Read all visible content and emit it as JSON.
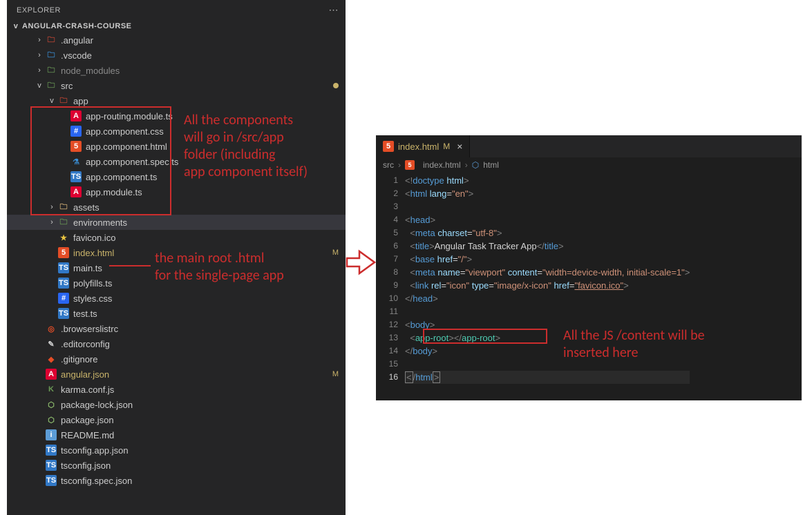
{
  "explorer": {
    "title": "EXPLORER",
    "project": "ANGULAR-CRASH-COURSE",
    "tree": [
      {
        "depth": 2,
        "chev": "›",
        "icon": "ic-folder-red",
        "label": ".angular"
      },
      {
        "depth": 2,
        "chev": "›",
        "icon": "ic-folder-blue",
        "label": ".vscode"
      },
      {
        "depth": 2,
        "chev": "›",
        "icon": "ic-folder-green",
        "label": "node_modules",
        "dim": true
      },
      {
        "depth": 2,
        "chev": "v",
        "icon": "ic-folder-green",
        "label": "src",
        "dot": true
      },
      {
        "depth": 3,
        "chev": "v",
        "icon": "ic-folder-red",
        "label": "app"
      },
      {
        "depth": 4,
        "chev": "",
        "icon": "ic-ng",
        "label": "app-routing.module.ts"
      },
      {
        "depth": 4,
        "chev": "",
        "icon": "ic-css",
        "label": "app.component.css"
      },
      {
        "depth": 4,
        "chev": "",
        "icon": "ic-html",
        "label": "app.component.html"
      },
      {
        "depth": 4,
        "chev": "",
        "icon": "ic-flask",
        "label": "app.component.spec.ts"
      },
      {
        "depth": 4,
        "chev": "",
        "icon": "ic-ts",
        "label": "app.component.ts"
      },
      {
        "depth": 4,
        "chev": "",
        "icon": "ic-ng",
        "label": "app.module.ts"
      },
      {
        "depth": 3,
        "chev": "›",
        "icon": "ic-folder",
        "label": "assets"
      },
      {
        "depth": 3,
        "chev": "›",
        "icon": "ic-folder-star",
        "label": "environments",
        "sel": true
      },
      {
        "depth": 3,
        "chev": "",
        "icon": "ic-star",
        "label": "favicon.ico"
      },
      {
        "depth": 3,
        "chev": "",
        "icon": "ic-html",
        "label": "index.html",
        "mod": true,
        "badge": "M"
      },
      {
        "depth": 3,
        "chev": "",
        "icon": "ic-ts",
        "label": "main.ts"
      },
      {
        "depth": 3,
        "chev": "",
        "icon": "ic-ts",
        "label": "polyfills.ts"
      },
      {
        "depth": 3,
        "chev": "",
        "icon": "ic-css",
        "label": "styles.css"
      },
      {
        "depth": 3,
        "chev": "",
        "icon": "ic-ts",
        "label": "test.ts"
      },
      {
        "depth": 2,
        "chev": "",
        "icon": "ic-browsers",
        "label": ".browserslistrc"
      },
      {
        "depth": 2,
        "chev": "",
        "icon": "ic-edit",
        "label": ".editorconfig"
      },
      {
        "depth": 2,
        "chev": "",
        "icon": "ic-git",
        "label": ".gitignore"
      },
      {
        "depth": 2,
        "chev": "",
        "icon": "ic-ng",
        "label": "angular.json",
        "mod": true,
        "badge": "M"
      },
      {
        "depth": 2,
        "chev": "",
        "icon": "ic-karma",
        "label": "karma.conf.js"
      },
      {
        "depth": 2,
        "chev": "",
        "icon": "ic-pkg",
        "label": "package-lock.json"
      },
      {
        "depth": 2,
        "chev": "",
        "icon": "ic-pkg",
        "label": "package.json"
      },
      {
        "depth": 2,
        "chev": "",
        "icon": "ic-readme",
        "label": "README.md"
      },
      {
        "depth": 2,
        "chev": "",
        "icon": "ic-ts",
        "label": "tsconfig.app.json"
      },
      {
        "depth": 2,
        "chev": "",
        "icon": "ic-ts",
        "label": "tsconfig.json"
      },
      {
        "depth": 2,
        "chev": "",
        "icon": "ic-ts",
        "label": "tsconfig.spec.json"
      }
    ]
  },
  "editor": {
    "tab": {
      "filename": "index.html",
      "modified": "M",
      "close": "×"
    },
    "crumbs": {
      "folder": "src",
      "file": "index.html",
      "symbol": "html"
    },
    "code_lines": [
      {
        "n": 1,
        "html": "<span class='t-gray'>&lt;!</span><span class='t-blue'>doctype</span> <span class='t-lblue'>html</span><span class='t-gray'>&gt;</span>"
      },
      {
        "n": 2,
        "html": "<span class='t-gray'>&lt;</span><span class='t-blue'>html</span> <span class='t-lblue'>lang</span><span class='t-white'>=</span><span class='t-str'>\"en\"</span><span class='t-gray'>&gt;</span>"
      },
      {
        "n": 3,
        "html": ""
      },
      {
        "n": 4,
        "html": "<span class='t-gray'>&lt;</span><span class='t-blue'>head</span><span class='t-gray'>&gt;</span>"
      },
      {
        "n": 5,
        "html": "  <span class='t-gray'>&lt;</span><span class='t-blue'>meta</span> <span class='t-lblue'>charset</span><span class='t-white'>=</span><span class='t-str'>\"utf-8\"</span><span class='t-gray'>&gt;</span>"
      },
      {
        "n": 6,
        "html": "  <span class='t-gray'>&lt;</span><span class='t-blue'>title</span><span class='t-gray'>&gt;</span><span class='t-white'>Angular Task Tracker App</span><span class='t-gray'>&lt;/</span><span class='t-blue'>title</span><span class='t-gray'>&gt;</span>"
      },
      {
        "n": 7,
        "html": "  <span class='t-gray'>&lt;</span><span class='t-blue'>base</span> <span class='t-lblue'>href</span><span class='t-white'>=</span><span class='t-str'>\"/\"</span><span class='t-gray'>&gt;</span>"
      },
      {
        "n": 8,
        "html": "  <span class='t-gray'>&lt;</span><span class='t-blue'>meta</span> <span class='t-lblue'>name</span><span class='t-white'>=</span><span class='t-str'>\"viewport\"</span> <span class='t-lblue'>content</span><span class='t-white'>=</span><span class='t-str'>\"width=device-width, initial-scale=1\"</span><span class='t-gray'>&gt;</span>"
      },
      {
        "n": 9,
        "html": "  <span class='t-gray'>&lt;</span><span class='t-blue'>link</span> <span class='t-lblue'>rel</span><span class='t-white'>=</span><span class='t-str'>\"icon\"</span> <span class='t-lblue'>type</span><span class='t-white'>=</span><span class='t-str'>\"image/x-icon\"</span> <span class='t-lblue'>href</span><span class='t-white'>=</span><span class='t-str' style='text-decoration:underline'>\"favicon.ico\"</span><span class='t-gray'>&gt;</span>"
      },
      {
        "n": 10,
        "html": "<span class='t-gray'>&lt;/</span><span class='t-blue'>head</span><span class='t-gray'>&gt;</span>"
      },
      {
        "n": 11,
        "html": ""
      },
      {
        "n": 12,
        "html": "<span class='t-gray'>&lt;</span><span class='t-blue'>body</span><span class='t-gray'>&gt;</span>"
      },
      {
        "n": 13,
        "html": "  <span class='t-gray'>&lt;</span><span class='t-teal'>app-root</span><span class='t-gray'>&gt;&lt;/</span><span class='t-teal'>app-root</span><span class='t-gray'>&gt;</span>"
      },
      {
        "n": 14,
        "html": "<span class='t-gray'>&lt;/</span><span class='t-blue'>body</span><span class='t-gray'>&gt;</span>"
      },
      {
        "n": 15,
        "html": ""
      },
      {
        "n": 16,
        "html": "<span class='caretbox'><span class='t-gray'>&lt;</span></span><span class='t-gray'>/</span><span class='t-blue'>html</span><span class='caretbox'><span class='t-gray'>&gt;</span></span>",
        "current": true
      }
    ]
  },
  "annotations": {
    "a1": "All the components\nwill go in /src/app\nfolder (including\napp component itself)",
    "a2": "the main root .html\nfor the single-page app",
    "a3": "All the JS /content will be\ninserted here"
  },
  "icon_glyphs": {
    "ic-folder": "🗀",
    "ic-folder-red": "🗀",
    "ic-folder-blue": "🗀",
    "ic-folder-green": "🗀",
    "ic-folder-star": "🗀",
    "ic-ng": "A",
    "ic-css": "#",
    "ic-html": "5",
    "ic-ts": "TS",
    "ic-flask": "⚗",
    "ic-star": "★",
    "ic-json": "{}",
    "ic-git": "◆",
    "ic-karma": "K",
    "ic-browsers": "◎",
    "ic-readme": "i",
    "ic-edit": "✎",
    "ic-pkg": "⬡"
  }
}
